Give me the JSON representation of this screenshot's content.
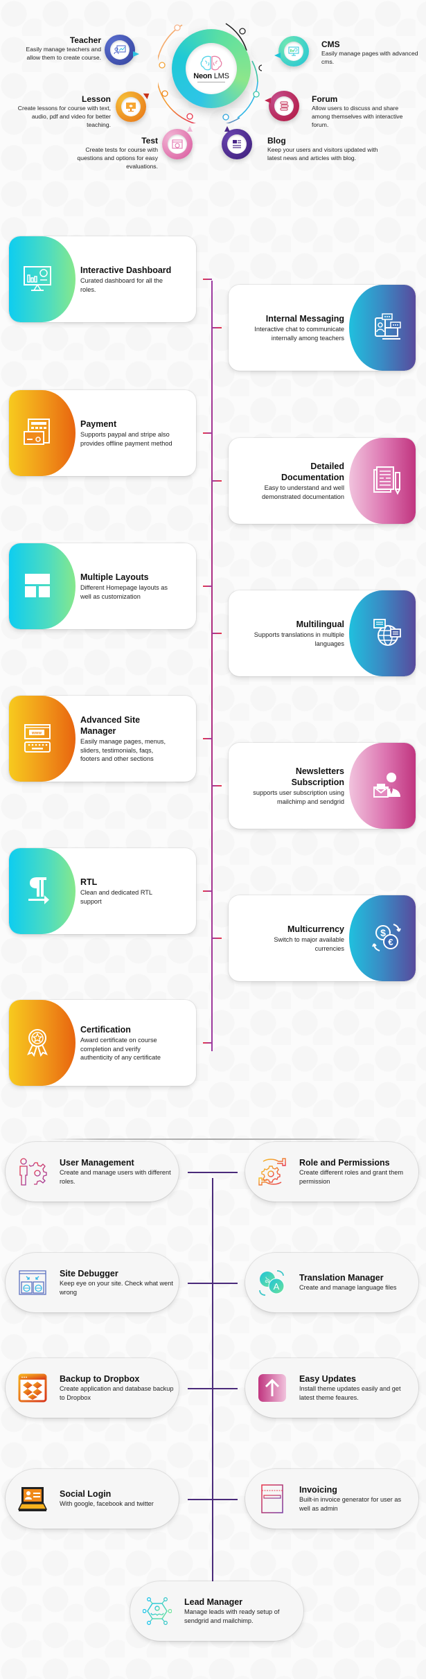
{
  "hub": {
    "brand_bold": "Neon",
    "brand_light": " LMS",
    "features": [
      {
        "title": "Teacher",
        "description": "Easily manage teachers and allow them to create course.",
        "icon": "teacher-presentation-icon",
        "color": "#3b4fa8"
      },
      {
        "title": "Lesson",
        "description": "Create lessons for course with text, audio, pdf and video for better teaching.",
        "icon": "lesson-monitor-icon",
        "color": "#f08a1a"
      },
      {
        "title": "Test",
        "description": "Create tests for course with questions and options for easy evaluations.",
        "icon": "test-browser-icon",
        "color": "#e06aa8"
      },
      {
        "title": "CMS",
        "description": "Easily manage pages with advanced cms.",
        "icon": "cms-monitor-icon",
        "color": "#28c7d8"
      },
      {
        "title": "Forum",
        "description": "Allow users to discuss and share among themselves with interactive forum.",
        "icon": "forum-stack-icon",
        "color": "#c0264f"
      },
      {
        "title": "Blog",
        "description": "Keep your users and visitors updated with latest news and articles with blog.",
        "icon": "blog-article-icon",
        "color": "#4a2788"
      }
    ]
  },
  "timeline": {
    "line_colors": [
      "#e8344a",
      "#9b3aa0"
    ],
    "left": [
      {
        "title": "Interactive Dashboard",
        "description": "Curated dashboard for all the roles.",
        "icon": "dashboard-monitor-icon",
        "gradient": "teal"
      },
      {
        "title": "Payment",
        "description": "Supports paypal and stripe also provides offline payment method",
        "icon": "payment-card-icon",
        "gradient": "orange"
      },
      {
        "title": "Multiple Layouts",
        "description": "Different Homepage layouts as well as customization",
        "icon": "layout-grid-icon",
        "gradient": "teal"
      },
      {
        "title": "Advanced Site Manager",
        "description": "Easily manage pages, menus, sliders, testimonials, faqs, footers and other sections",
        "icon": "www-keyboard-icon",
        "gradient": "orange"
      },
      {
        "title": "RTL",
        "description": "Clean and dedicated RTL support",
        "icon": "rtl-pilcrow-icon",
        "gradient": "teal"
      },
      {
        "title": "Certification",
        "description": "Award certificate on course completion and verify authenticity of any certificate",
        "icon": "award-ribbon-icon",
        "gradient": "orange"
      }
    ],
    "right": [
      {
        "title": "Internal Messaging",
        "description": "Interactive chat to communicate internally among teachers",
        "icon": "chat-devices-icon",
        "gradient": "indigo"
      },
      {
        "title": "Detailed Documentation",
        "description": "Easy to understand and well demonstrated documentation",
        "icon": "document-pen-icon",
        "gradient": "pink"
      },
      {
        "title": "Multilingual",
        "description": "Supports translations in multiple languages",
        "icon": "globe-chat-icon",
        "gradient": "indigo"
      },
      {
        "title": "Newsletters Subscription",
        "description": "supports user subscription using mailchimp and sendgrid",
        "icon": "user-envelope-icon",
        "gradient": "pink"
      },
      {
        "title": "Multicurrency",
        "description": "Switch to major available currencies",
        "icon": "currency-exchange-icon",
        "gradient": "indigo"
      }
    ]
  },
  "tools": {
    "line_color": "#4a2a7a",
    "left": [
      {
        "title": "User Management",
        "description": "Create and manage users with different roles.",
        "icon": "user-gear-icon"
      },
      {
        "title": "Site Debugger",
        "description": "Keep eye on your site. Check what went wrong",
        "icon": "browser-debug-icon"
      },
      {
        "title": "Backup to Dropbox",
        "description": "Create application and database backup to Dropbox",
        "icon": "dropbox-icon"
      },
      {
        "title": "Social Login",
        "description": "With google, facebook and twitter",
        "icon": "laptop-profile-icon"
      }
    ],
    "right": [
      {
        "title": "Role and Permissions",
        "description": "Create different roles and grant them permission",
        "icon": "hands-gear-icon"
      },
      {
        "title": "Translation Manager",
        "description": "Create and manage language files",
        "icon": "translate-icon"
      },
      {
        "title": "Easy Updates",
        "description": "Install theme updates easily and get latest theme feaures.",
        "icon": "arrow-up-icon"
      },
      {
        "title": "Invoicing",
        "description": "Built-in invoice generator for user as well as admin",
        "icon": "invoice-icon"
      }
    ],
    "bottom": {
      "title": "Lead Manager",
      "description": "Manage leads with ready setup of sendgrid and mailchimp.",
      "icon": "lead-network-icon"
    }
  }
}
